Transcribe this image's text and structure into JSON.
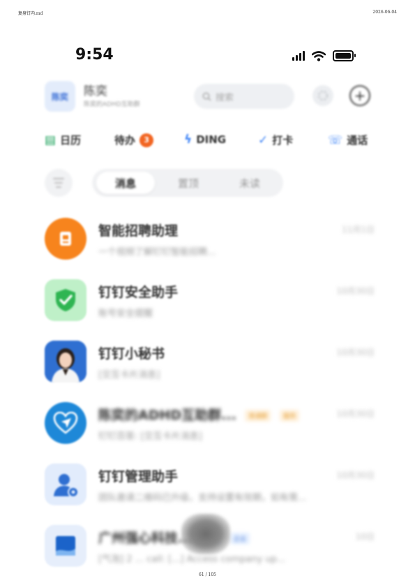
{
  "pdf": {
    "header_left": "复身钉内.md",
    "header_right": "2026-06-04",
    "footer": "61 / 105"
  },
  "status_bar": {
    "time": "9:54",
    "icons": [
      "signal-icon",
      "wifi-icon",
      "battery-icon"
    ],
    "battery_level": 0.85
  },
  "header": {
    "org_avatar_text": "陈奕",
    "user_name": "陈奕",
    "user_subtitle": "陈奕的ADHD互助群",
    "search_placeholder": "搜索",
    "icons": [
      "search-icon",
      "settings-icon",
      "add-icon"
    ]
  },
  "shortcuts": [
    {
      "label": "日历",
      "icon": "calendar-icon",
      "color": "#18a058"
    },
    {
      "label": "待办",
      "icon": "todo-icon",
      "badge": "3",
      "color": "#f26522"
    },
    {
      "label": "DING",
      "icon": "ding-icon",
      "color": "#3b82f6"
    },
    {
      "label": "打卡",
      "icon": "check-in-icon",
      "color": "#3b82f6"
    },
    {
      "label": "通话",
      "icon": "call-icon",
      "color": "#3b82f6"
    }
  ],
  "filters": {
    "icon": "filter-icon",
    "tabs": [
      {
        "label": "消息",
        "active": true
      },
      {
        "label": "置顶",
        "active": false
      },
      {
        "label": "未读",
        "active": false
      }
    ]
  },
  "chats": [
    {
      "title": "智能招聘助理",
      "preview": "一个视频了解钉钉智能招聘...",
      "time": "11月1日",
      "avatar": "recruit-assistant-icon",
      "color": "#f7841d"
    },
    {
      "title": "钉钉安全助手",
      "preview": "账号安全提醒",
      "time": "10月30日",
      "avatar": "shield-check-icon",
      "color": "#34c759"
    },
    {
      "title": "钉钉小秘书",
      "preview": "[交互卡片消息]",
      "time": "10月30日",
      "avatar": "secretary-avatar",
      "color": "#2f6fd1"
    },
    {
      "title": "陈奕的ADHD互助群...",
      "preview": "钉钉百答: [交互卡片消息]",
      "time": "10月30日",
      "avatar": "heart-plane-icon",
      "color": "#1e88d8",
      "tags": [
        "普通群",
        "服务"
      ]
    },
    {
      "title": "钉钉管理助手",
      "preview": "团队邀请二维码已升级，支持设置有效期，如有需...",
      "time": "10月30日",
      "avatar": "admin-user-icon",
      "color": "#3b82f6"
    },
    {
      "title": "广州强心科技...",
      "preview": "[气泡] 2 ... call: [...] Access company up...",
      "time": "10日",
      "avatar": "company-avatar",
      "color": "#1b63c9",
      "tags": [
        "外部",
        "企业"
      ]
    }
  ]
}
